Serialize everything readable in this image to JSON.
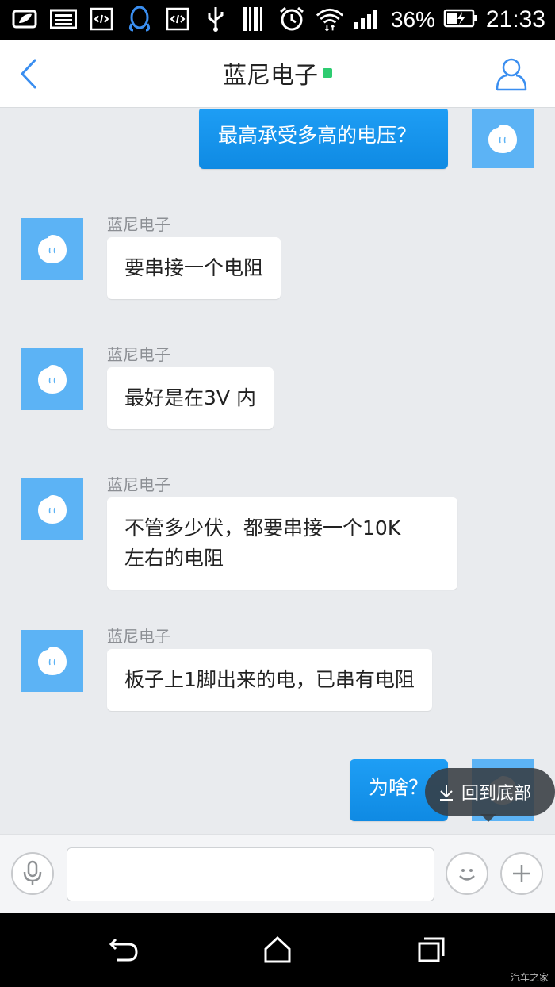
{
  "status_bar": {
    "battery_percent": "36%",
    "time": "21:33",
    "icons": [
      "battery-saver-icon",
      "image-icon",
      "code-icon",
      "qq-icon",
      "code-icon",
      "usb-icon",
      "barcode-icon",
      "alarm-icon",
      "wifi-icon",
      "signal-icon",
      "battery-icon"
    ]
  },
  "header": {
    "title": "蓝尼电子",
    "online_color": "#2ecc71",
    "back_icon": "chevron-left-icon",
    "profile_icon": "user-icon"
  },
  "messages": [
    {
      "direction": "out",
      "text": "最高承受多高的电压？"
    },
    {
      "direction": "in",
      "sender": "蓝尼电子",
      "text": "要串接一个电阻"
    },
    {
      "direction": "in",
      "sender": "蓝尼电子",
      "text": "最好是在3V 内"
    },
    {
      "direction": "in",
      "sender": "蓝尼电子",
      "lines": [
        "不管多少伏，都要串接一个10K",
        "左右的电阻"
      ]
    },
    {
      "direction": "in",
      "sender": "蓝尼电子",
      "text": "板子上1脚出来的电，已串有电阻"
    },
    {
      "direction": "out",
      "text": "为啥？"
    }
  ],
  "to_bottom": {
    "label": "回到底部",
    "icon": "arrow-down-icon"
  },
  "input_bar": {
    "voice_icon": "microphone-icon",
    "placeholder": "",
    "emoji_icon": "smiley-icon",
    "more_icon": "plus-icon"
  },
  "nav_bar": {
    "back_icon": "back-arrow-icon",
    "home_icon": "home-icon",
    "recents_icon": "recents-icon"
  },
  "watermark": "汽车之家",
  "colors": {
    "accent": "#1e9ef5",
    "avatar_bg": "#5cb3f5",
    "chat_bg": "#e9ebee"
  }
}
